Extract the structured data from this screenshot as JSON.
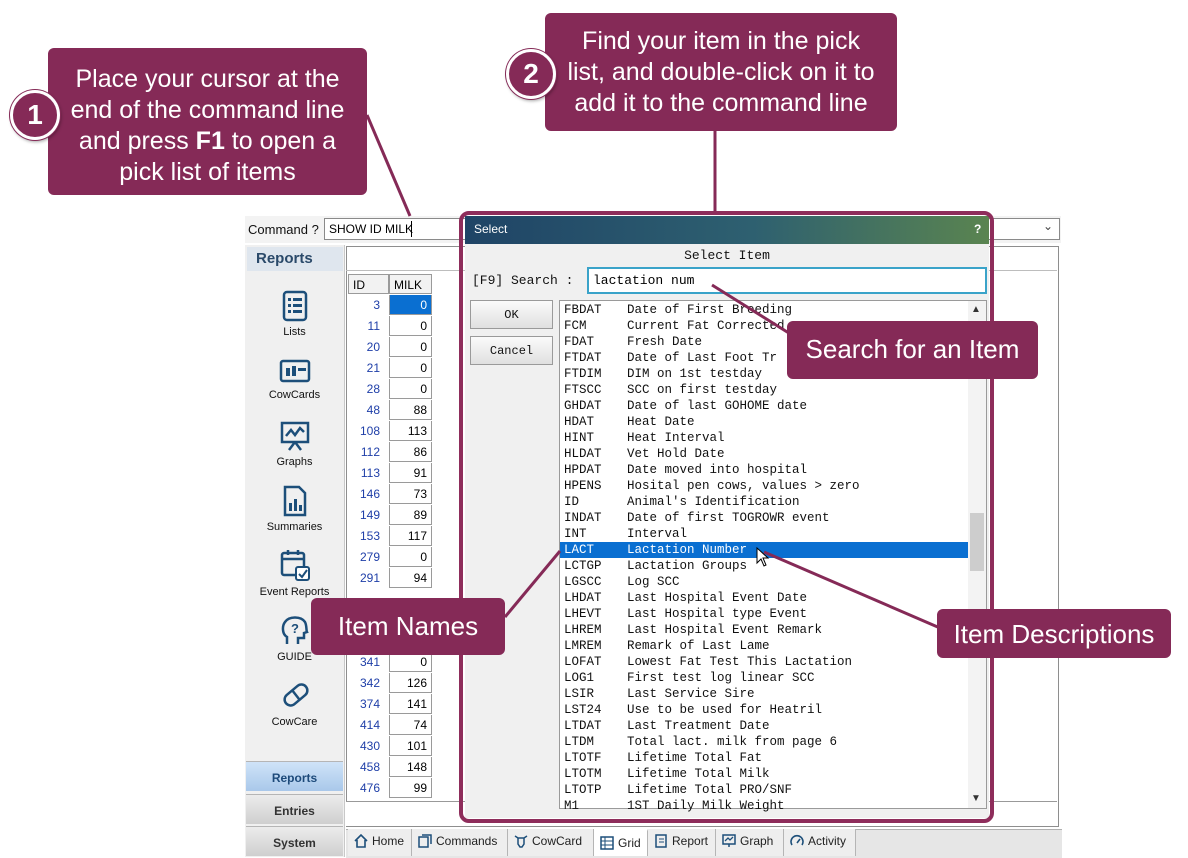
{
  "command": {
    "label": "Command ?",
    "value": "SHOW ID MILK"
  },
  "sidebar": {
    "title": "Reports",
    "items": [
      {
        "label": "Lists",
        "icon": "list-icon"
      },
      {
        "label": "CowCards",
        "icon": "cowcard-icon"
      },
      {
        "label": "Graphs",
        "icon": "graph-icon"
      },
      {
        "label": "Summaries",
        "icon": "summary-icon"
      },
      {
        "label": "Event Reports",
        "icon": "calendar-icon"
      },
      {
        "label": "GUIDE",
        "icon": "guide-icon"
      },
      {
        "label": "CowCare",
        "icon": "capsule-icon"
      }
    ],
    "sections": [
      "Reports",
      "Entries",
      "System"
    ]
  },
  "grid": {
    "headers": [
      "ID",
      "MILK"
    ],
    "rows_top": [
      [
        "3",
        "0"
      ],
      [
        "11",
        "0"
      ],
      [
        "20",
        "0"
      ],
      [
        "21",
        "0"
      ],
      [
        "28",
        "0"
      ],
      [
        "48",
        "88"
      ],
      [
        "108",
        "113"
      ],
      [
        "112",
        "86"
      ],
      [
        "113",
        "91"
      ],
      [
        "146",
        "73"
      ],
      [
        "149",
        "89"
      ],
      [
        "153",
        "117"
      ],
      [
        "279",
        "0"
      ],
      [
        "291",
        "94"
      ]
    ],
    "rows_bottom": [
      [
        "341",
        "0"
      ],
      [
        "342",
        "126"
      ],
      [
        "374",
        "141"
      ],
      [
        "414",
        "74"
      ],
      [
        "430",
        "101"
      ],
      [
        "458",
        "148"
      ],
      [
        "476",
        "99"
      ]
    ]
  },
  "tabs": [
    {
      "label": "Home",
      "icon": "home-icon"
    },
    {
      "label": "Commands",
      "icon": "commands-icon"
    },
    {
      "label": "CowCard",
      "icon": "cow-icon"
    },
    {
      "label": "Grid",
      "icon": "grid-icon"
    },
    {
      "label": "Report",
      "icon": "report-icon"
    },
    {
      "label": "Graph",
      "icon": "graph-tab-icon"
    },
    {
      "label": "Activity",
      "icon": "activity-icon"
    }
  ],
  "dialog": {
    "title": "Select",
    "help": "?",
    "heading": "Select Item",
    "search_label": "[F9] Search :",
    "search_value": "lactation num",
    "ok_label": "OK",
    "cancel_label": "Cancel",
    "items": [
      [
        "FBDAT",
        "Date of First Breeding"
      ],
      [
        "FCM",
        "Current Fat Corrected"
      ],
      [
        "FDAT",
        "Fresh Date"
      ],
      [
        "FTDAT",
        "Date of Last Foot Tr"
      ],
      [
        "FTDIM",
        "DIM on 1st testday"
      ],
      [
        "FTSCC",
        "SCC on first testday"
      ],
      [
        "GHDAT",
        "Date of last GOHOME date"
      ],
      [
        "HDAT",
        "Heat Date"
      ],
      [
        "HINT",
        "Heat Interval"
      ],
      [
        "HLDAT",
        "Vet Hold Date"
      ],
      [
        "HPDAT",
        "Date moved into hospital"
      ],
      [
        "HPENS",
        "Hosital pen cows, values > zero"
      ],
      [
        "ID",
        "Animal's Identification"
      ],
      [
        "INDAT",
        "Date of first TOGROWR event"
      ],
      [
        "INT",
        "Interval"
      ],
      [
        "LACT",
        "Lactation Number"
      ],
      [
        "LCTGP",
        "Lactation Groups"
      ],
      [
        "LGSCC",
        "Log SCC"
      ],
      [
        "LHDAT",
        "Last Hospital Event Date"
      ],
      [
        "LHEVT",
        "Last Hospital type Event"
      ],
      [
        "LHREM",
        "Last Hospital Event Remark"
      ],
      [
        "LMREM",
        "Remark of Last Lame"
      ],
      [
        "LOFAT",
        "Lowest Fat Test This Lactation"
      ],
      [
        "LOG1",
        "First test log linear SCC"
      ],
      [
        "LSIR",
        "Last Service Sire"
      ],
      [
        "LST24",
        "Use to be used for Heatril"
      ],
      [
        "LTDAT",
        "Last Treatment Date"
      ],
      [
        "LTDM",
        "Total lact. milk from page 6"
      ],
      [
        "LTOTF",
        "Lifetime Total Fat"
      ],
      [
        "LTOTM",
        "Lifetime Total Milk"
      ],
      [
        "LTOTP",
        "Lifetime Total PRO/SNF"
      ],
      [
        "M1",
        "1ST Daily Milk Weight"
      ]
    ],
    "selected_index": 15
  },
  "callouts": {
    "step1_number": "1",
    "step1_text_a": "Place your cursor at the",
    "step1_text_b": "end of the command line",
    "step1_text_c": "and press ",
    "step1_text_key": "F1",
    "step1_text_d": " to open a",
    "step1_text_e": "pick list of items",
    "step2_number": "2",
    "step2_text_a": "Find your item in the pick",
    "step2_text_b": "list, and double-click on it to",
    "step2_text_c": "add it to the command line",
    "search": "Search for an Item",
    "names": "Item Names",
    "descriptions": "Item Descriptions"
  },
  "colors": {
    "callout": "#852a57",
    "selection": "#0a6fd1",
    "id_text": "#1f3fa8"
  }
}
